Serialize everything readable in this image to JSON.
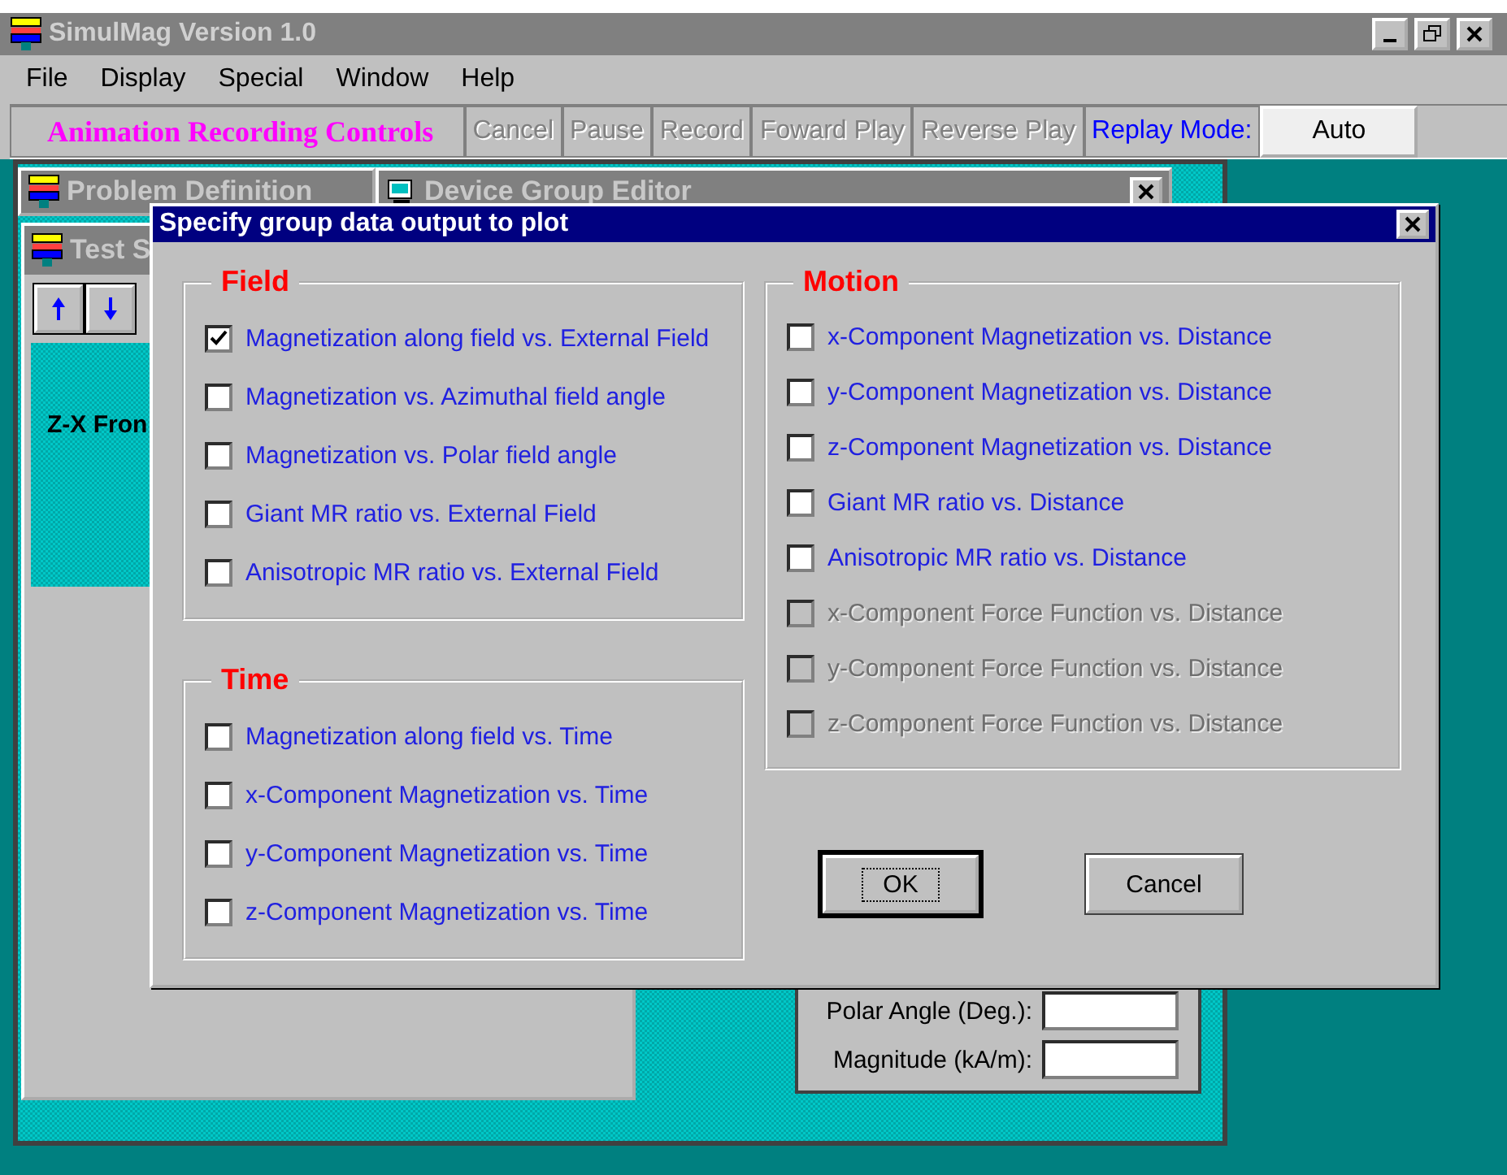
{
  "window": {
    "title": "SimulMag Version 1.0"
  },
  "menu": [
    "File",
    "Display",
    "Special",
    "Window",
    "Help"
  ],
  "toolbar": {
    "title": "Animation Recording Controls",
    "buttons": [
      {
        "label": "Cancel",
        "disabled": true
      },
      {
        "label": "Pause",
        "disabled": true
      },
      {
        "label": "Record",
        "disabled": true
      },
      {
        "label": "Foward Play",
        "disabled": true
      },
      {
        "label": "Reverse Play",
        "disabled": true
      }
    ],
    "mode_label": "Replay Mode:",
    "mode_value": "Auto"
  },
  "problem_window": {
    "title": "Problem Definition"
  },
  "editor_window": {
    "title": "Device Group Editor",
    "fields": [
      {
        "label": "Polar Angle (Deg.):"
      },
      {
        "label": "Magnitude (kA/m):"
      }
    ]
  },
  "test_window": {
    "title": "Test S",
    "view_label": "Z-X Fron"
  },
  "dialog": {
    "title": "Specify group data output to plot",
    "groups": [
      {
        "title": "Field",
        "items": [
          {
            "label": "Magnetization along field vs. External Field",
            "checked": true,
            "disabled": false
          },
          {
            "label": "Magnetization vs. Azimuthal field angle",
            "checked": false,
            "disabled": false
          },
          {
            "label": "Magnetization vs. Polar field angle",
            "checked": false,
            "disabled": false
          },
          {
            "label": "Giant MR ratio vs. External Field",
            "checked": false,
            "disabled": false
          },
          {
            "label": "Anisotropic MR ratio vs. External Field",
            "checked": false,
            "disabled": false
          }
        ]
      },
      {
        "title": "Time",
        "items": [
          {
            "label": "Magnetization along field vs. Time",
            "checked": false,
            "disabled": false
          },
          {
            "label": "x-Component Magnetization vs. Time",
            "checked": false,
            "disabled": false
          },
          {
            "label": "y-Component Magnetization vs. Time",
            "checked": false,
            "disabled": false
          },
          {
            "label": "z-Component Magnetization vs. Time",
            "checked": false,
            "disabled": false
          }
        ]
      },
      {
        "title": "Motion",
        "items": [
          {
            "label": "x-Component Magnetization vs. Distance",
            "checked": false,
            "disabled": false
          },
          {
            "label": "y-Component Magnetization vs. Distance",
            "checked": false,
            "disabled": false
          },
          {
            "label": "z-Component Magnetization vs. Distance",
            "checked": false,
            "disabled": false
          },
          {
            "label": "Giant MR ratio vs. Distance",
            "checked": false,
            "disabled": false
          },
          {
            "label": "Anisotropic MR ratio vs. Distance",
            "checked": false,
            "disabled": false
          },
          {
            "label": "x-Component Force Function vs. Distance",
            "checked": false,
            "disabled": true
          },
          {
            "label": "y-Component Force Function vs. Distance",
            "checked": false,
            "disabled": true
          },
          {
            "label": "z-Component Force Function vs. Distance",
            "checked": false,
            "disabled": true
          }
        ]
      }
    ],
    "buttons": [
      {
        "label": "OK",
        "focused": true
      },
      {
        "label": "Cancel",
        "focused": false
      }
    ]
  }
}
